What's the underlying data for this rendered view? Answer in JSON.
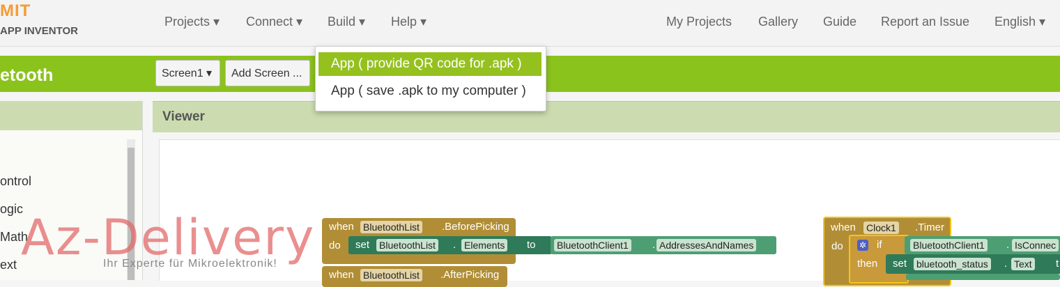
{
  "logo": {
    "mit": "MIT",
    "sub": "APP INVENTOR"
  },
  "nav_left": [
    "Projects ▾",
    "Connect ▾",
    "Build ▾",
    "Help ▾"
  ],
  "nav_right": [
    "My Projects",
    "Gallery",
    "Guide",
    "Report an Issue",
    "English ▾"
  ],
  "build_menu": [
    "App ( provide QR code for .apk )",
    "App ( save .apk to my computer )"
  ],
  "project": {
    "title": "etooth",
    "screen_select": "Screen1 ▾",
    "add_screen": "Add Screen ..."
  },
  "palette": {
    "items": [
      "ontrol",
      "ogic",
      "Math",
      "ext"
    ]
  },
  "viewer": {
    "title": "Viewer"
  },
  "blocks": {
    "before_picking": {
      "when": "when",
      "component": "BluetoothList",
      "event": ".BeforePicking",
      "do": "do",
      "set": "set",
      "set_component": "BluetoothList",
      "property": "Elements",
      "to": "to",
      "get_component": "BluetoothClient1",
      "get_property": "AddressesAndNames"
    },
    "after_picking": {
      "when": "when",
      "component": "BluetoothList",
      "event": ".AfterPicking"
    },
    "timer": {
      "when": "when",
      "component": "Clock1",
      "event": ".Timer",
      "do": "do",
      "if": "if",
      "cond_component": "BluetoothClient1",
      "cond_property": "IsConnec",
      "then": "then",
      "set": "set",
      "set_component": "bluetooth_status",
      "set_property": "Text",
      "t": "t"
    }
  },
  "watermark": {
    "brand": "Az-Delivery",
    "tagline": "Ihr Experte für Mikroelektronik!"
  },
  "colors": {
    "accent_green": "#8bc31d",
    "menu_highlight": "#95c11f",
    "event_block": "#b18e35",
    "component_block": "#2f7a59",
    "logo_orange": "#f39c34"
  }
}
